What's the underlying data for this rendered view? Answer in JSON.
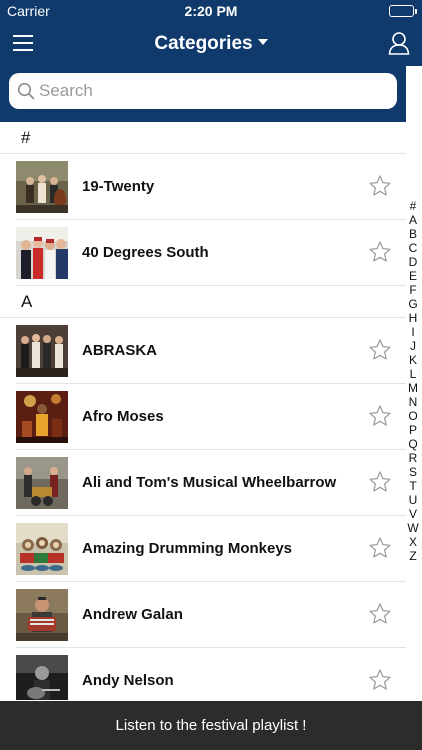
{
  "status_bar": {
    "carrier": "Carrier",
    "time": "2:20 PM"
  },
  "nav": {
    "title": "Categories"
  },
  "search": {
    "placeholder": "Search"
  },
  "sections": [
    {
      "header": "#",
      "items": [
        {
          "title": "19-Twenty"
        },
        {
          "title": "40 Degrees South"
        }
      ]
    },
    {
      "header": "A",
      "items": [
        {
          "title": "ABRASKA"
        },
        {
          "title": "Afro Moses"
        },
        {
          "title": "Ali and Tom's Musical Wheelbarrow"
        },
        {
          "title": "Amazing Drumming Monkeys"
        },
        {
          "title": "Andrew Galan"
        },
        {
          "title": "Andy Nelson"
        }
      ]
    }
  ],
  "index": [
    "#",
    "A",
    "B",
    "C",
    "D",
    "E",
    "F",
    "G",
    "H",
    "I",
    "J",
    "K",
    "L",
    "M",
    "N",
    "O",
    "P",
    "Q",
    "R",
    "S",
    "T",
    "U",
    "V",
    "W",
    "X",
    "Z"
  ],
  "footer": {
    "label": "Listen to the festival playlist !"
  },
  "colors": {
    "nav_background": "#0f3a6b",
    "footer_background": "#2c2c2c"
  }
}
